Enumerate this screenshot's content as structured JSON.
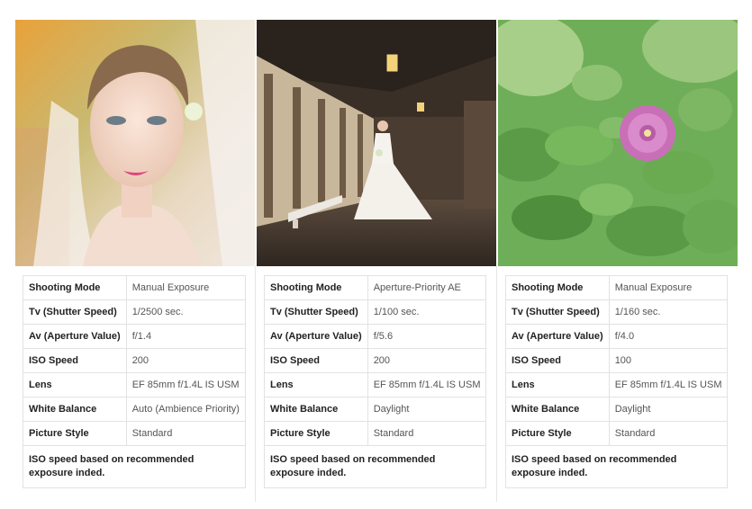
{
  "columns": [
    {
      "photo_icon": "bridal-portrait-photo",
      "rows": [
        {
          "label": "Shooting Mode",
          "value": "Manual Exposure"
        },
        {
          "label": "Tv (Shutter Speed)",
          "value": "1/2500 sec."
        },
        {
          "label": "Av (Aperture Value)",
          "value": "f/1.4"
        },
        {
          "label": "ISO Speed",
          "value": "200"
        },
        {
          "label": "Lens",
          "value": "EF 85mm f/1.4L IS USM"
        },
        {
          "label": "White Balance",
          "value": "Auto (Ambience Priority)"
        },
        {
          "label": "Picture Style",
          "value": "Standard"
        }
      ],
      "note": "ISO speed based on recommended exposure inded."
    },
    {
      "photo_icon": "bride-in-hallway-photo",
      "rows": [
        {
          "label": "Shooting Mode",
          "value": "Aperture-Priority AE"
        },
        {
          "label": "Tv (Shutter Speed)",
          "value": "1/100 sec."
        },
        {
          "label": "Av (Aperture Value)",
          "value": "f/5.6"
        },
        {
          "label": "ISO Speed",
          "value": "200"
        },
        {
          "label": "Lens",
          "value": "EF 85mm f/1.4L IS USM"
        },
        {
          "label": "White Balance",
          "value": "Daylight"
        },
        {
          "label": "Picture Style",
          "value": "Standard"
        }
      ],
      "note": "ISO speed based on recommended exposure inded."
    },
    {
      "photo_icon": "pink-flower-photo",
      "rows": [
        {
          "label": "Shooting Mode",
          "value": "Manual Exposure"
        },
        {
          "label": "Tv (Shutter Speed)",
          "value": "1/160 sec."
        },
        {
          "label": "Av (Aperture Value)",
          "value": "f/4.0"
        },
        {
          "label": "ISO Speed",
          "value": "100"
        },
        {
          "label": "Lens",
          "value": "EF 85mm f/1.4L IS USM"
        },
        {
          "label": "White Balance",
          "value": "Daylight"
        },
        {
          "label": "Picture Style",
          "value": "Standard"
        }
      ],
      "note": "ISO speed based on recommended exposure inded."
    }
  ]
}
